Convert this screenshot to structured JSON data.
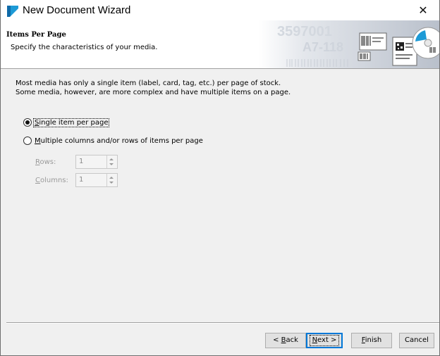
{
  "window": {
    "title": "New Document Wizard",
    "close_glyph": "✕"
  },
  "header": {
    "title": "Items Per Page",
    "subtitle": "Specify the characteristics of your media.",
    "banner_text_1": "3597001",
    "banner_text_2": "A7-118"
  },
  "main": {
    "description": "Most media has only a single item (label, card, tag, etc.) per page of stock. Some media, however, are more complex and have multiple items on a page.",
    "options": [
      {
        "accel": "S",
        "rest": "ingle item per page",
        "checked": true
      },
      {
        "accel": "M",
        "rest": "ultiple columns and/or rows of items per page",
        "checked": false
      }
    ],
    "rows": {
      "accel": "R",
      "rest": "ows:",
      "value": "1"
    },
    "columns": {
      "accel": "C",
      "rest": "olumns:",
      "value": "1"
    }
  },
  "buttons": {
    "back_prefix": "< ",
    "back_accel": "B",
    "back_rest": "ack",
    "next_accel": "N",
    "next_rest": "ext >",
    "finish_accel": "F",
    "finish_rest": "inish",
    "cancel": "Cancel"
  },
  "colors": {
    "accent": "#0078d7",
    "app_icon": "#1d9ad6"
  }
}
